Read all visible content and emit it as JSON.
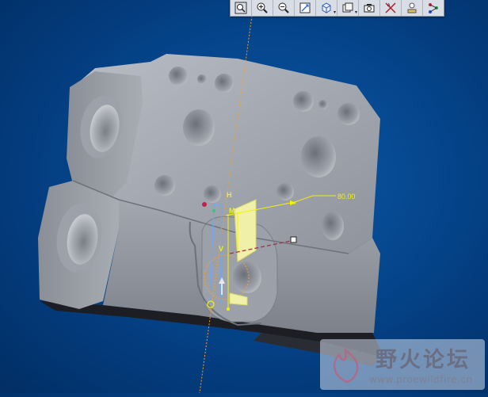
{
  "toolbar": {
    "buttons": [
      {
        "name": "zoom-fit-icon"
      },
      {
        "name": "zoom-in-icon"
      },
      {
        "name": "zoom-out-icon"
      },
      {
        "name": "refit-icon"
      },
      {
        "name": "view-orientation-icon",
        "dropdown": true
      },
      {
        "name": "saved-views-icon",
        "dropdown": true
      },
      {
        "name": "capture-icon"
      },
      {
        "name": "datum-display-icon"
      },
      {
        "name": "spin-center-icon"
      },
      {
        "name": "sketch-constraints-icon"
      }
    ]
  },
  "dimension": {
    "value": "80.00",
    "labels": [
      "H",
      "M",
      "V"
    ]
  },
  "watermark": {
    "title": "野火论坛",
    "url": "www.proewildfire.cn"
  },
  "colors": {
    "background": "#064a93",
    "part": "#9a9ea6",
    "dimension": "#f4f200",
    "datum": "#f0a030",
    "selection": "#6aa8ff"
  }
}
